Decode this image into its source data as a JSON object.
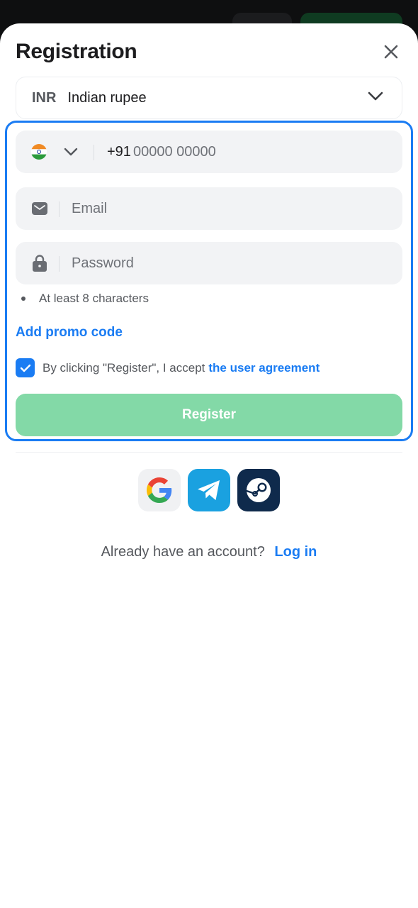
{
  "sheet": {
    "title": "Registration",
    "close_icon": "close-icon"
  },
  "currency": {
    "code": "INR",
    "name": "Indian rupee",
    "icon": "chevron-down-icon"
  },
  "phone": {
    "country_flag": "india-flag-icon",
    "prefix": "+91",
    "placeholder": "00000 00000"
  },
  "email": {
    "icon": "mail-icon",
    "placeholder": "Email"
  },
  "password": {
    "icon": "lock-icon",
    "placeholder": "Password",
    "rule": "At least 8 characters"
  },
  "promo": {
    "label": "Add promo code"
  },
  "agreement": {
    "checked": true,
    "text": "By clicking \"Register\", I accept",
    "link": "the user agreement"
  },
  "register_button": {
    "label": "Register"
  },
  "social": [
    "google-icon",
    "telegram-icon",
    "steam-icon"
  ],
  "login": {
    "prompt": "Already have an account?",
    "link": "Log in"
  },
  "colors": {
    "accent": "#1a7cf3",
    "register_disabled": "#83d9a7",
    "field_bg": "#f2f3f5"
  }
}
